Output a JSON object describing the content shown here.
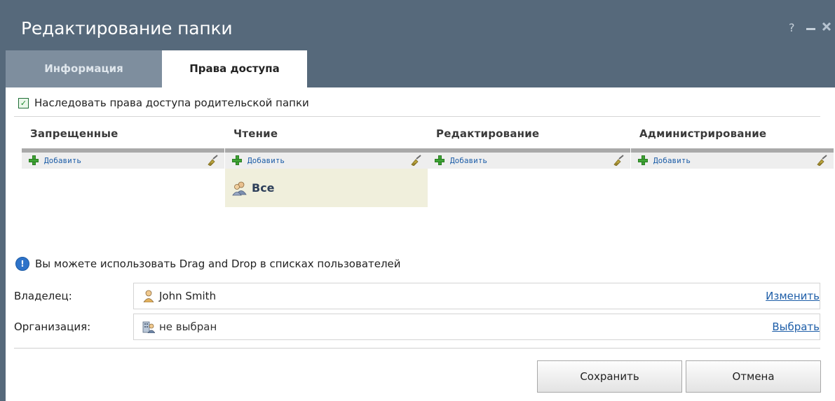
{
  "window": {
    "title": "Редактирование папки",
    "help_glyph": "?",
    "minimize_glyph": "‒",
    "close_glyph": "✕"
  },
  "tabs": [
    {
      "label": "Информация",
      "active": false
    },
    {
      "label": "Права доступа",
      "active": true
    }
  ],
  "inherit": {
    "checked": true,
    "label": "Наследовать права доступа родительской папки"
  },
  "columns": [
    {
      "title": "Запрещенные",
      "add_label": "Добавить",
      "items": []
    },
    {
      "title": "Чтение",
      "add_label": "Добавить",
      "items": [
        {
          "label": "Все",
          "icon": "users-group-icon"
        }
      ]
    },
    {
      "title": "Редактирование",
      "add_label": "Добавить",
      "items": []
    },
    {
      "title": "Администрирование",
      "add_label": "Добавить",
      "items": []
    }
  ],
  "hint": {
    "text": "Вы можете использовать Drag and Drop в списках пользователей",
    "icon": "info-icon"
  },
  "owner": {
    "label": "Владелец:",
    "value": "John Smith",
    "icon": "user-icon",
    "action": "Изменить"
  },
  "organization": {
    "label": "Организация:",
    "value": "не выбран",
    "icon": "organization-icon",
    "action": "Выбрать"
  },
  "buttons": {
    "save": "Сохранить",
    "cancel": "Отмена"
  },
  "colors": {
    "titlebar": "#56697b",
    "inactive_tab": "#7e8e9e",
    "link": "#1e5ea8",
    "selected_group_bg": "#f0efdc"
  }
}
